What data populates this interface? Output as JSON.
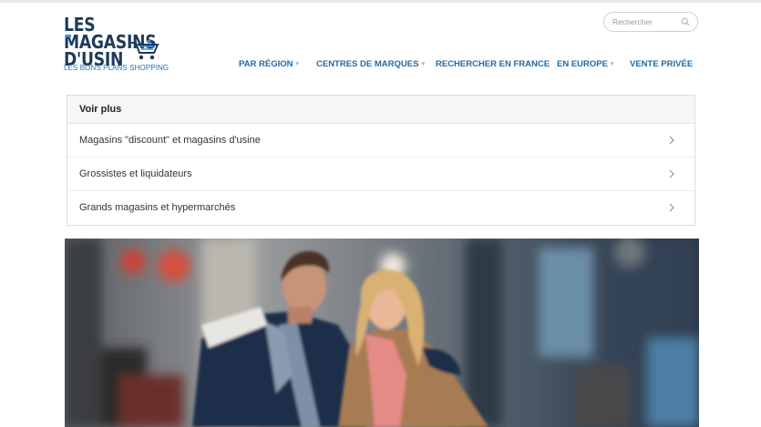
{
  "logo": {
    "title_line1": "LES MAGASINS",
    "title_line2": "D'USIN",
    "tagline": "LES BONS PLANS SHOPPING"
  },
  "search": {
    "placeholder": "Rechercher"
  },
  "nav": [
    {
      "label": "PAR RÉGION",
      "has_dropdown": true
    },
    {
      "label": "CENTRES DE MARQUES",
      "has_dropdown": true
    },
    {
      "label": "RECHERCHER EN FRANCE",
      "has_dropdown": false
    },
    {
      "label": "EN EUROPE",
      "has_dropdown": true
    },
    {
      "label": "VENTE PRIVÉE",
      "has_dropdown": false
    }
  ],
  "panel": {
    "title": "Voir plus",
    "items": [
      "Magasins \"discount\" et magasins d'usine",
      "Grossistes et liquidateurs",
      "Grands magasins et hypermarchés"
    ]
  },
  "hero": {
    "image": "couple-shopping-photo"
  },
  "colors": {
    "nav_blue": "#1f6aa6",
    "logo_navy": "#1f3a5a",
    "tagline_blue": "#2a6fb0"
  }
}
